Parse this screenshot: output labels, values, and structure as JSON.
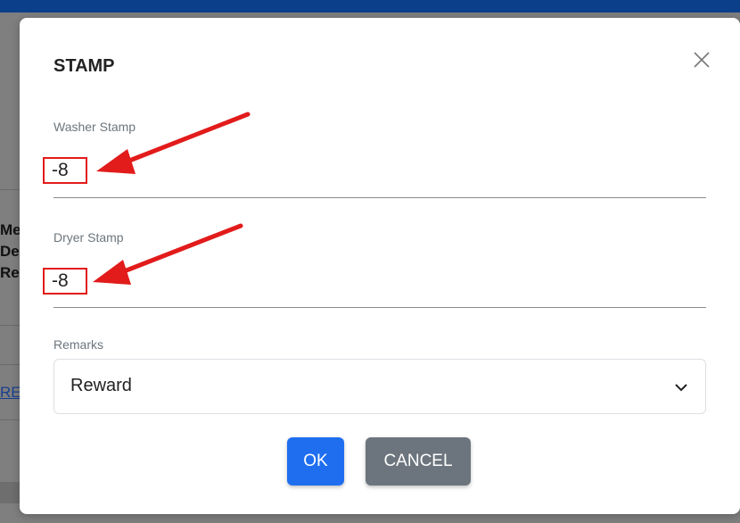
{
  "background": {
    "fragments": [
      "Me",
      "De",
      "Re"
    ],
    "link_fragment": "RE"
  },
  "modal": {
    "title": "STAMP",
    "washer": {
      "label": "Washer Stamp",
      "value": "-8"
    },
    "dryer": {
      "label": "Dryer Stamp",
      "value": "-8"
    },
    "remarks": {
      "label": "Remarks",
      "selected": "Reward"
    },
    "ok_label": "OK",
    "cancel_label": "CANCEL"
  },
  "colors": {
    "ok_button": "#1f6ef0",
    "cancel_button": "#6c757d",
    "annotation": "#e21b1b",
    "topbar": "#0b3f8a"
  }
}
